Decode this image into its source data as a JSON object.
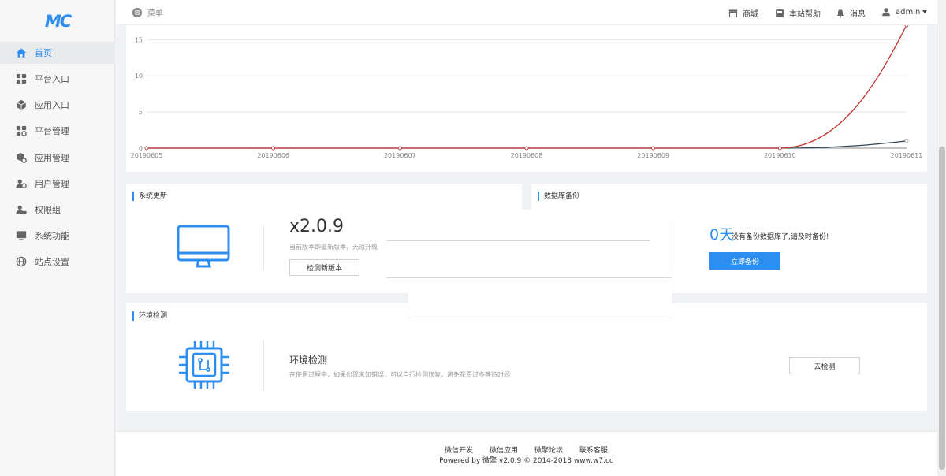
{
  "logo": {
    "text": "MC"
  },
  "sidebar": {
    "items": [
      {
        "label": "首页",
        "icon": "home-icon"
      },
      {
        "label": "平台入口",
        "icon": "grid-icon"
      },
      {
        "label": "应用入口",
        "icon": "cube-icon"
      },
      {
        "label": "平台管理",
        "icon": "grid-gear-icon"
      },
      {
        "label": "应用管理",
        "icon": "cube-gear-icon"
      },
      {
        "label": "用户管理",
        "icon": "users-icon"
      },
      {
        "label": "权限组",
        "icon": "user-lock-icon"
      },
      {
        "label": "系统功能",
        "icon": "monitor-icon"
      },
      {
        "label": "站点设置",
        "icon": "globe-icon"
      }
    ]
  },
  "header": {
    "menu_label": "菜单",
    "shop_label": "商城",
    "help_label": "本站帮助",
    "message_label": "消息",
    "user_label": "admin"
  },
  "chart_data": {
    "type": "line",
    "categories": [
      "20190605",
      "20190606",
      "20190607",
      "20190608",
      "20190609",
      "20190610",
      "20190611"
    ],
    "y_ticks": [
      0,
      5,
      10,
      15
    ],
    "ylim": [
      0,
      17
    ],
    "series": [
      {
        "values": [
          0,
          0,
          0,
          0,
          0,
          0,
          1
        ],
        "color": "#2f4554"
      },
      {
        "values": [
          0,
          0,
          0,
          0,
          0,
          0,
          17
        ],
        "color": "#c23531"
      }
    ]
  },
  "update": {
    "title": "系统更新",
    "version": "x2.0.9",
    "desc": "当前版本即最新版本，无须升级",
    "button": "检测新版本"
  },
  "backup": {
    "title": "数据库备份",
    "days": "0天",
    "text": "没有备份数据库了,请及时备份!",
    "button": "立即备份"
  },
  "env": {
    "section_title": "环境检测",
    "title": "环境检测",
    "desc": "在使用过程中，如果出现未知错误，可以自行检测修复，避免花费过多等待时间",
    "button": "去检测"
  },
  "footer": {
    "links": [
      "微信开发",
      "微信应用",
      "微擎论坛",
      "联系客服"
    ],
    "copyright": "Powered by 微擎 v2.0.9 © 2014-2018 www.w7.cc"
  }
}
